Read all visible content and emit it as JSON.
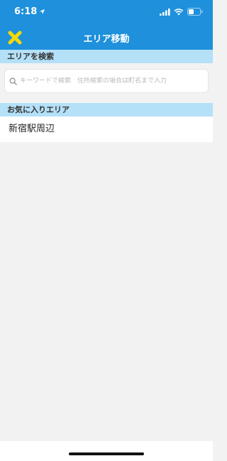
{
  "status_bar": {
    "time": "6:18"
  },
  "nav": {
    "title": "エリア移動",
    "close_icon": "close-x-icon",
    "close_color": "#f5d90a"
  },
  "search": {
    "header": "エリアを検索",
    "placeholder": "キーワードで検索　住所検索の場合は町名まで入力",
    "value": ""
  },
  "favorites": {
    "header": "お気に入りエリア",
    "items": [
      {
        "label": "新宿駅周辺"
      }
    ]
  },
  "colors": {
    "header_bg": "#1e90dc",
    "section_bg": "#b4e0f8",
    "page_bg": "#f2f2f2"
  }
}
